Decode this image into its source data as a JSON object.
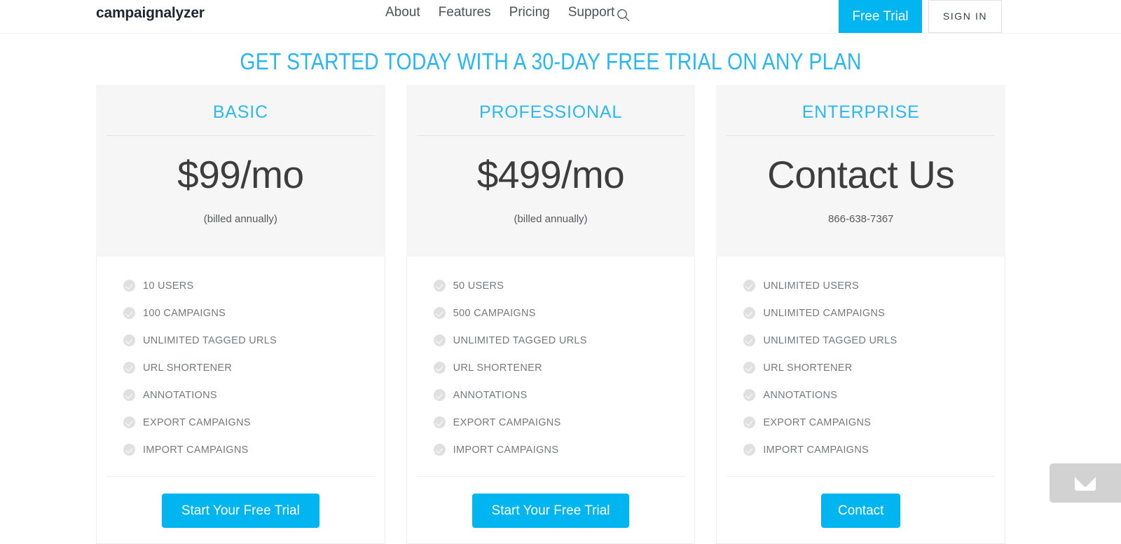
{
  "brand": {
    "logo_text": "campaignalyzer",
    "accent_color": "#00b5f0",
    "headline_color": "#29b6f6",
    "muted_text_color": "#77797c"
  },
  "nav": {
    "links": [
      {
        "label": "About"
      },
      {
        "label": "Features"
      },
      {
        "label": "Pricing"
      },
      {
        "label": "Support"
      }
    ],
    "search_icon": "search-icon",
    "free_trial_label": "Free Trial",
    "sign_in_label": "SIGN IN"
  },
  "headline": "GET STARTED TODAY WITH A 30-DAY FREE TRIAL ON ANY PLAN",
  "plans": [
    {
      "name": "BASIC",
      "price": "$99/mo",
      "note": "(billed annually)",
      "features": [
        "10 USERS",
        "100 CAMPAIGNS",
        "UNLIMITED TAGGED URLS",
        "URL SHORTENER",
        "ANNOTATIONS",
        "EXPORT CAMPAIGNS",
        "IMPORT CAMPAIGNS"
      ],
      "cta_label": "Start Your Free Trial"
    },
    {
      "name": "PROFESSIONAL",
      "price": "$499/mo",
      "note": "(billed annually)",
      "features": [
        "50 USERS",
        "500 CAMPAIGNS",
        "UNLIMITED TAGGED URLS",
        "URL SHORTENER",
        "ANNOTATIONS",
        "EXPORT CAMPAIGNS",
        "IMPORT CAMPAIGNS"
      ],
      "cta_label": "Start Your Free Trial"
    },
    {
      "name": "ENTERPRISE",
      "price": "Contact Us",
      "note": "866-638-7367",
      "features": [
        "UNLIMITED USERS",
        "UNLIMITED CAMPAIGNS",
        "UNLIMITED TAGGED URLS",
        "URL SHORTENER",
        "ANNOTATIONS",
        "EXPORT CAMPAIGNS",
        "IMPORT CAMPAIGNS"
      ],
      "cta_label": "Contact"
    }
  ],
  "contact_widget": {
    "icon": "envelope-icon"
  }
}
